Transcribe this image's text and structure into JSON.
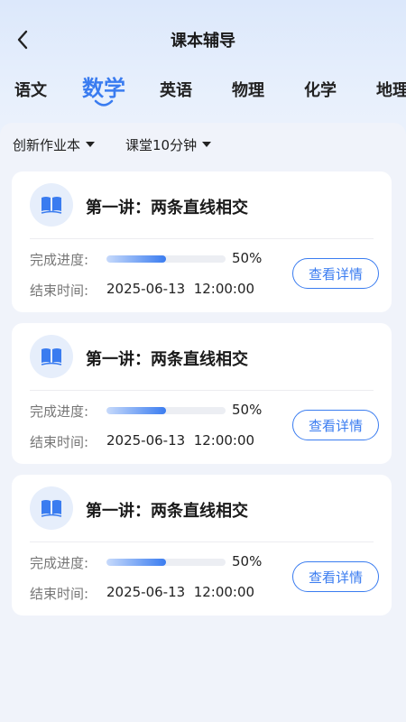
{
  "header": {
    "title": "课本辅导"
  },
  "tabs": [
    {
      "label": "语文"
    },
    {
      "label": "数学",
      "active": true
    },
    {
      "label": "英语"
    },
    {
      "label": "物理"
    },
    {
      "label": "化学"
    },
    {
      "label": "地理"
    }
  ],
  "filters": {
    "homework": "创新作业本",
    "duration": "课堂10分钟"
  },
  "colors": {
    "accent": "#3a7cf0"
  },
  "icons": {
    "back": "chevron-left-icon",
    "card": "open-book-icon",
    "filter": "caret-down-icon"
  },
  "cards": [
    {
      "title": "第一讲：两条直线相交",
      "progress_label": "完成进度:",
      "progress_value": "50%",
      "progress_fraction": 0.5,
      "end_label": "结束时间:",
      "end_value": "2025-06-13  12:00:00",
      "button": "查看详情"
    },
    {
      "title": "第一讲：两条直线相交",
      "progress_label": "完成进度:",
      "progress_value": "50%",
      "progress_fraction": 0.5,
      "end_label": "结束时间:",
      "end_value": "2025-06-13  12:00:00",
      "button": "查看详情"
    },
    {
      "title": "第一讲：两条直线相交",
      "progress_label": "完成进度:",
      "progress_value": "50%",
      "progress_fraction": 0.5,
      "end_label": "结束时间:",
      "end_value": "2025-06-13  12:00:00",
      "button": "查看详情"
    }
  ]
}
